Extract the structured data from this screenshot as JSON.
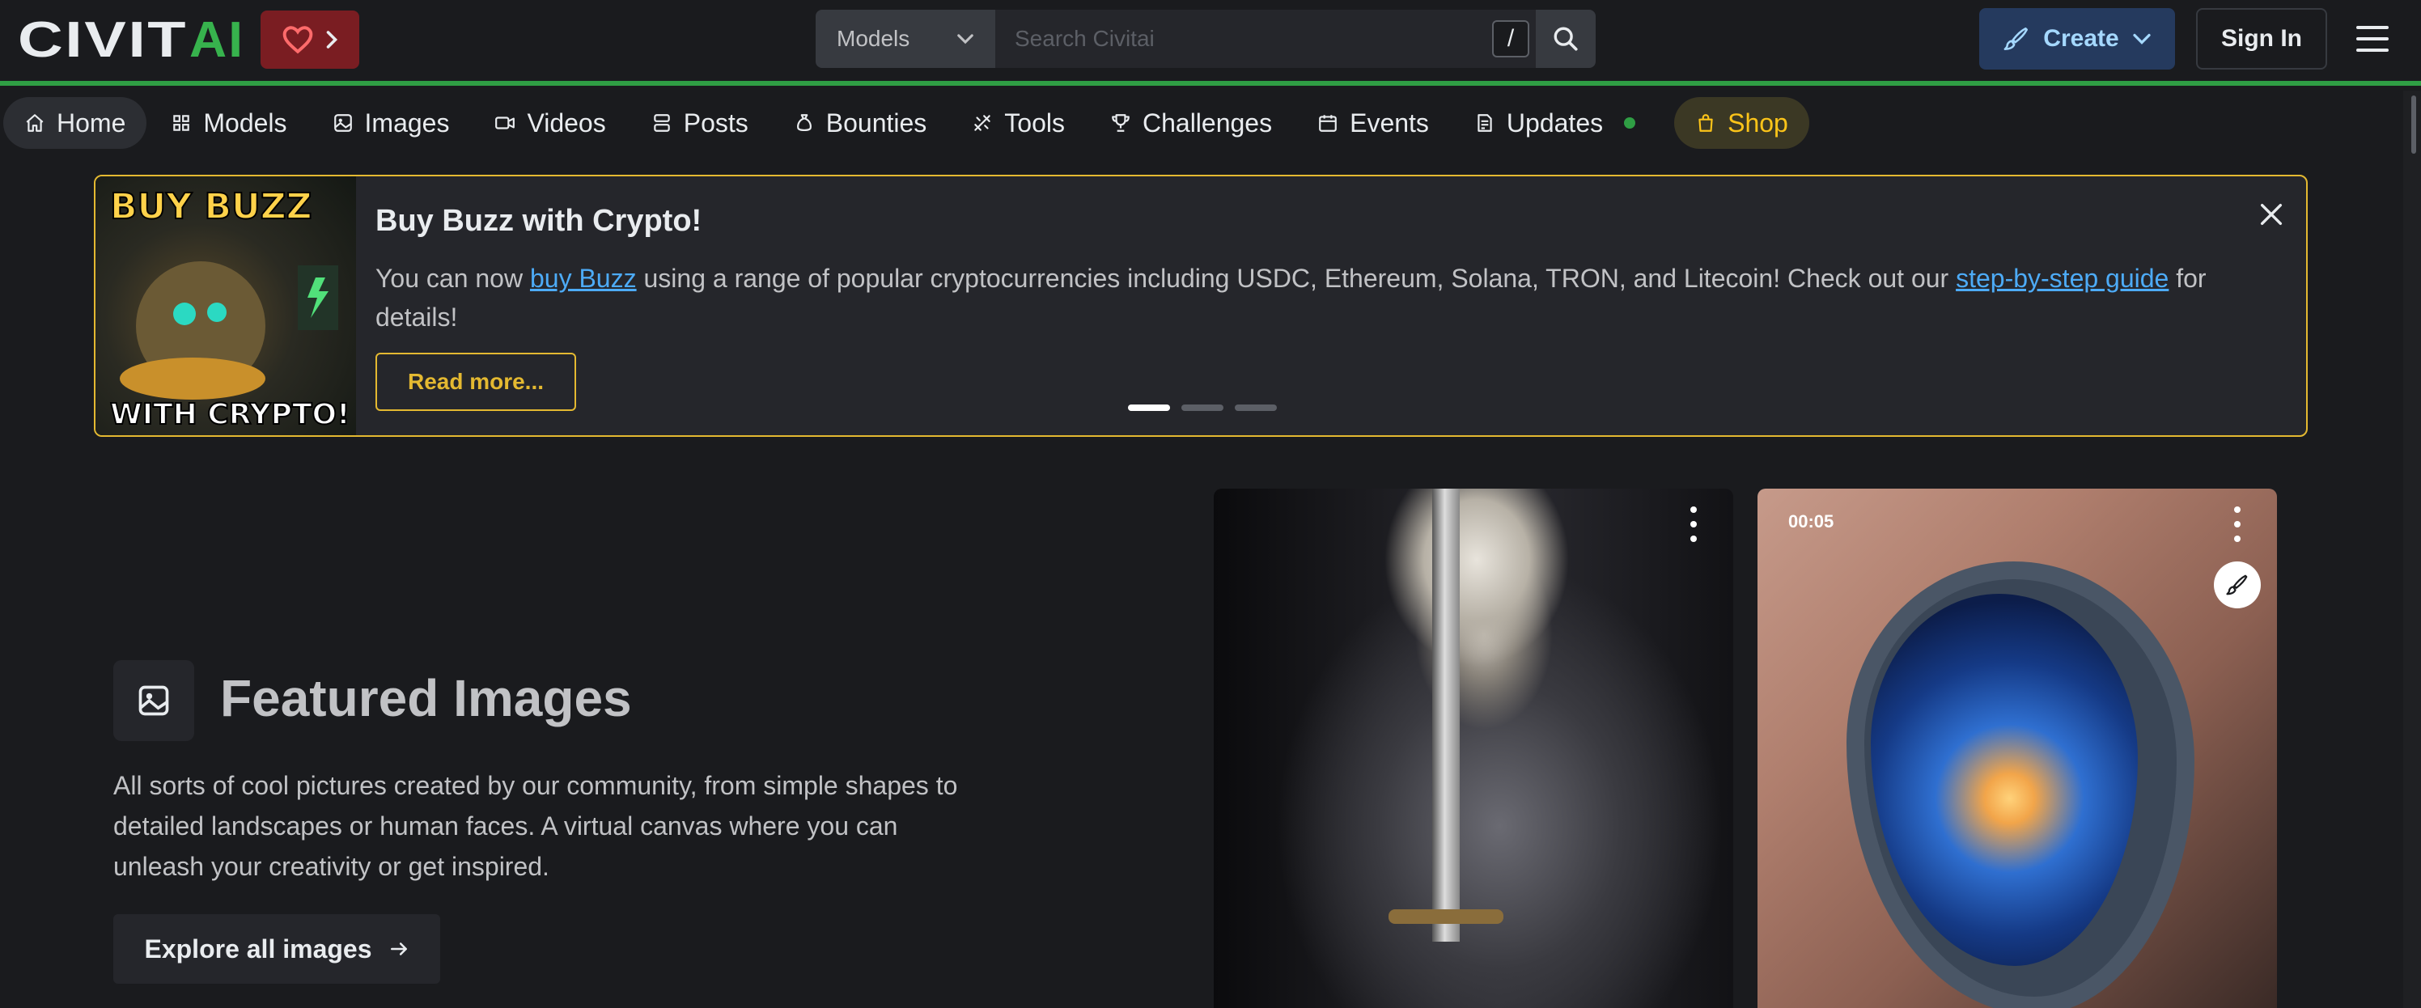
{
  "header": {
    "logo_text": "CIVITAI",
    "search": {
      "category": "Models",
      "placeholder": "Search Civitai",
      "shortcut": "/"
    },
    "create_label": "Create",
    "signin_label": "Sign In"
  },
  "nav": {
    "items": [
      {
        "label": "Home",
        "icon": "home-icon"
      },
      {
        "label": "Models",
        "icon": "grid-icon"
      },
      {
        "label": "Images",
        "icon": "image-icon"
      },
      {
        "label": "Videos",
        "icon": "video-icon"
      },
      {
        "label": "Posts",
        "icon": "posts-icon"
      },
      {
        "label": "Bounties",
        "icon": "moneybag-icon"
      },
      {
        "label": "Tools",
        "icon": "tools-icon"
      },
      {
        "label": "Challenges",
        "icon": "trophy-icon"
      },
      {
        "label": "Events",
        "icon": "calendar-icon"
      },
      {
        "label": "Updates",
        "icon": "updates-icon"
      },
      {
        "label": "Shop",
        "icon": "shopping-bag-icon"
      }
    ]
  },
  "banner": {
    "image_text_top": "BUY BUZZ",
    "image_text_bottom": "WITH CRYPTO!",
    "title": "Buy Buzz with Crypto!",
    "text_1": "You can now ",
    "link_1": "buy Buzz",
    "text_2": " using a range of popular cryptocurrencies including USDC, Ethereum, Solana, TRON, and Litecoin! Check out our ",
    "link_2": "step-by-step guide",
    "text_3": " for details!",
    "read_more": "Read more...",
    "slides": 3,
    "active_slide": 1
  },
  "featured": {
    "title": "Featured Images",
    "description": "All sorts of cool pictures created by our community, from simple shapes to detailed landscapes or human faces. A virtual canvas where you can unleash your creativity or get inspired.",
    "explore_label": "Explore all images"
  },
  "cards": [
    {
      "type": "image"
    },
    {
      "type": "video",
      "duration": "00:05"
    }
  ],
  "colors": {
    "accent_green": "#2f9e44",
    "banner_border": "#e4b931",
    "link": "#4dabf7",
    "shop": "#fcc419"
  }
}
